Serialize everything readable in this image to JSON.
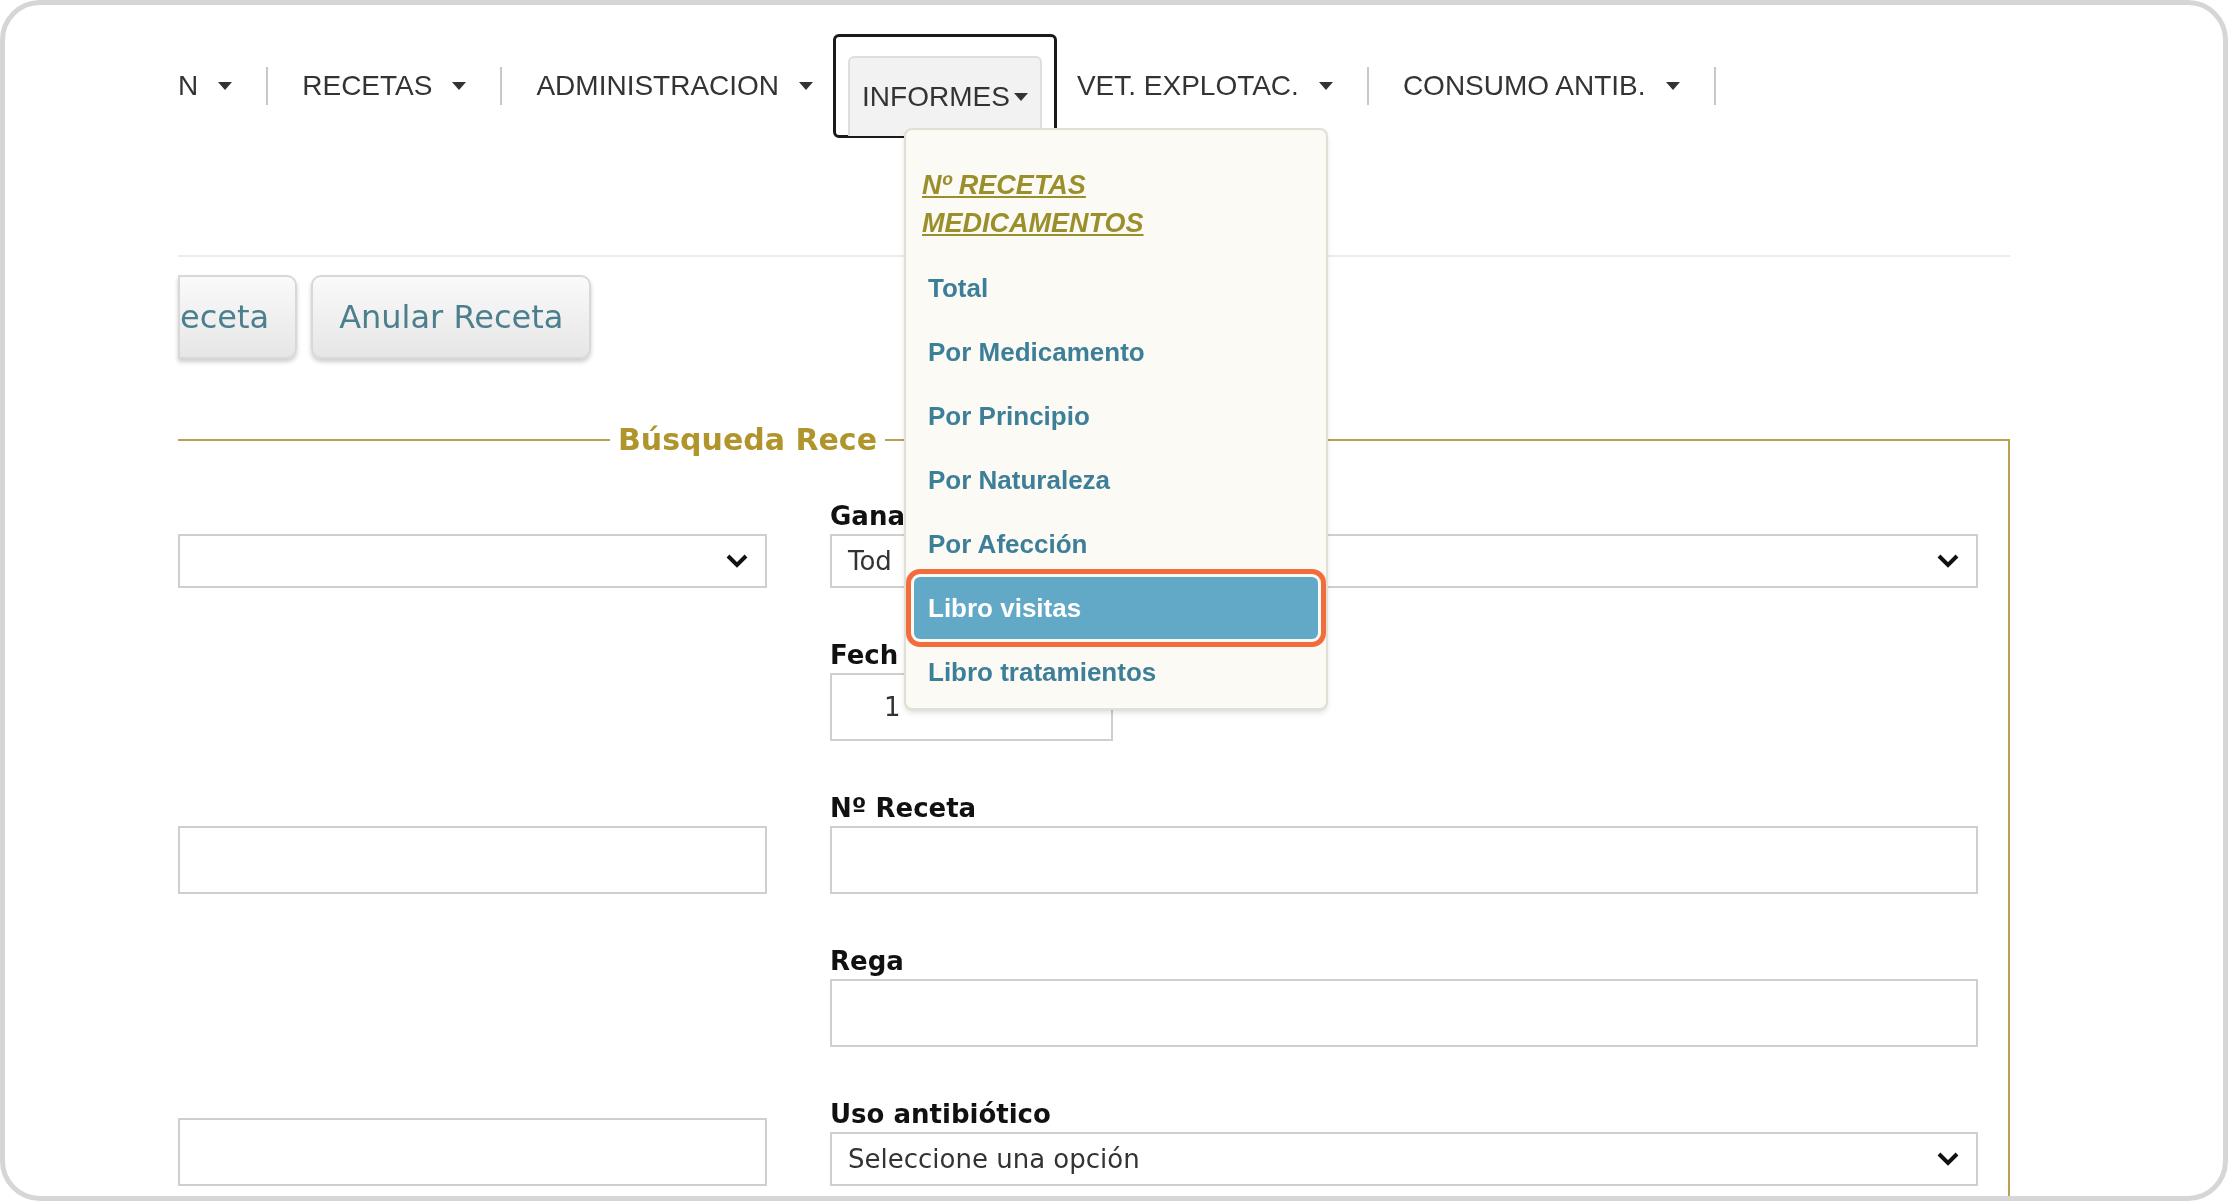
{
  "menu": [
    {
      "label": "N",
      "selected": false
    },
    {
      "label": "RECETAS",
      "selected": false
    },
    {
      "label": "ADMINISTRACION",
      "selected": false
    },
    {
      "label": "INFORMES",
      "selected": true
    },
    {
      "label": "VET. EXPLOTAC.",
      "selected": false
    },
    {
      "label": "CONSUMO ANTIB.",
      "selected": false
    }
  ],
  "dropdown": {
    "heading": "Nº RECETAS MEDICAMENTOS",
    "items": [
      {
        "label": "Total",
        "selected": false
      },
      {
        "label": "Por Medicamento",
        "selected": false
      },
      {
        "label": "Por Principio",
        "selected": false
      },
      {
        "label": "Por Naturaleza",
        "selected": false
      },
      {
        "label": "Por Afección",
        "selected": false
      },
      {
        "label": "Libro visitas",
        "selected": true
      },
      {
        "label": "Libro tratamientos",
        "selected": false
      }
    ]
  },
  "buttons": [
    "eceta",
    "Anular Receta"
  ],
  "search": {
    "legend": "Búsqueda Rece",
    "rows": [
      {
        "left": {
          "kind": "select"
        },
        "right": {
          "label": "Gana",
          "kind": "select",
          "value": "Tod"
        }
      },
      {
        "right": {
          "label": "Fech",
          "kind": "date",
          "value": "1"
        }
      },
      {
        "left": {
          "kind": "text"
        },
        "right": {
          "label": "Nº Receta",
          "kind": "text"
        }
      },
      {
        "right": {
          "label": "Rega",
          "kind": "text"
        }
      },
      {
        "left": {
          "kind": "text"
        },
        "right": {
          "label": "Uso antibiótico",
          "kind": "select",
          "value": "Seleccione una opción"
        }
      }
    ]
  }
}
